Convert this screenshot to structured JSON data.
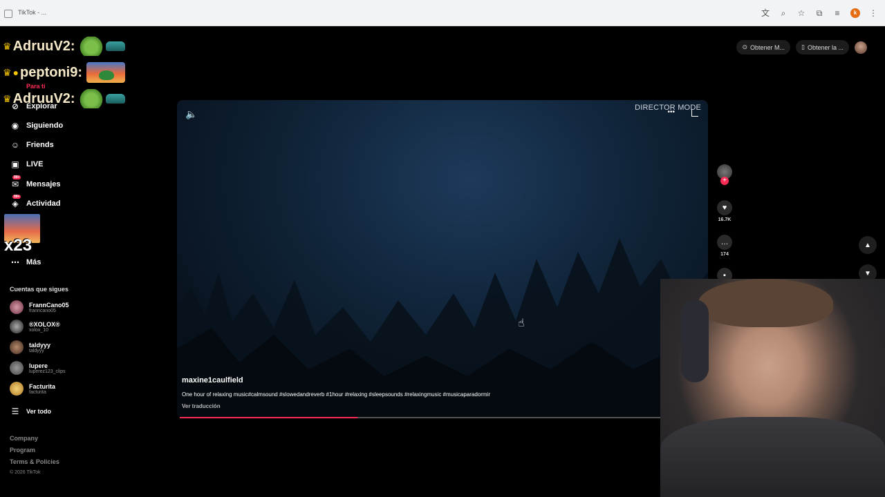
{
  "browser": {
    "url_text": "TikTok - ..."
  },
  "top_right": {
    "btn1": "Obtener M...",
    "btn2": "Obtener la ..."
  },
  "chat": [
    {
      "user": "AdruuV2:"
    },
    {
      "user": "peptoni9:"
    },
    {
      "user": "AdruuV2:"
    }
  ],
  "sidebar": {
    "items": [
      {
        "label": "Para ti"
      },
      {
        "label": "Explorar"
      },
      {
        "label": "Siguiendo"
      },
      {
        "label": "Friends"
      },
      {
        "label": "LIVE"
      },
      {
        "label": "Mensajes",
        "badge": "99+"
      },
      {
        "label": "Actividad",
        "badge": "99+"
      },
      {
        "label": "Más"
      }
    ],
    "overlay_text": "x23",
    "following_title": "Cuentas que sigues",
    "accounts": [
      {
        "name": "FrannCano05",
        "handle": "franncano05"
      },
      {
        "name": "®XOLOX®",
        "handle": "xolox_10"
      },
      {
        "name": "taldyyy",
        "handle": "taldyyy"
      },
      {
        "name": "lupere",
        "handle": "luperez123_clips"
      },
      {
        "name": "Facturita",
        "handle": "facturita"
      }
    ],
    "see_all": "Ver todo",
    "footer": [
      "Company",
      "Program",
      "Terms & Policies"
    ],
    "copyright": "© 2026 TikTok"
  },
  "video": {
    "overlay_title": "DIRECTOR MODE",
    "author": "maxine1caulfield",
    "description": "One hour of relaxing music#calmsound #slowedandreverb #1hour #relaxing #sleepsounds #relaxingmusic #musicaparadormir",
    "translate": "Ver traducción",
    "progress": 0.36
  },
  "actions": {
    "likes": "16.7K",
    "comments": "174"
  },
  "colors": {
    "accent": "#fe2c55",
    "background": "#000000"
  }
}
